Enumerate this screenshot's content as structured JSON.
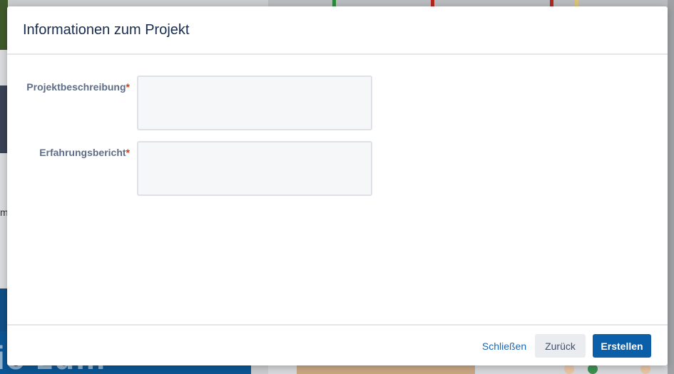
{
  "background": {
    "left_edge_text": "m",
    "bottom_left_text": "ie zum"
  },
  "dialog": {
    "title": "Informationen zum Projekt",
    "fields": [
      {
        "label": "Projektbeschreibung",
        "required_mark": "*",
        "value": "",
        "placeholder": ""
      },
      {
        "label": "Erfahrungsbericht",
        "required_mark": "*",
        "value": "",
        "placeholder": ""
      }
    ],
    "buttons": {
      "close": "Schließen",
      "back": "Zurück",
      "create": "Erstellen"
    }
  },
  "colors": {
    "title": "#172b4d",
    "label": "#5e6c84",
    "required": "#de350b",
    "primary": "#0b5ea8",
    "link": "#1a68b5"
  }
}
